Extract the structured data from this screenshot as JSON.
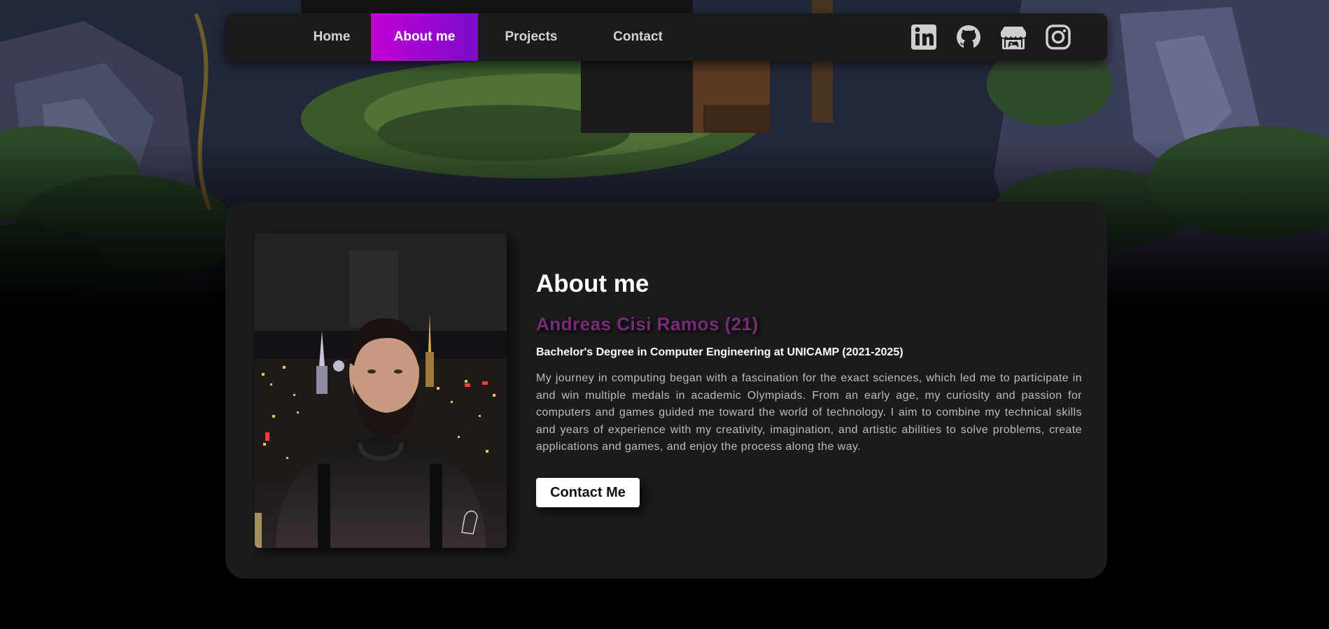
{
  "nav": {
    "items": [
      {
        "label": "Home",
        "active": false
      },
      {
        "label": "About me",
        "active": true
      },
      {
        "label": "Projects",
        "active": false
      },
      {
        "label": "Contact",
        "active": false
      }
    ],
    "social_icons": [
      "linkedin-icon",
      "github-icon",
      "itch-io-icon",
      "instagram-icon"
    ]
  },
  "about": {
    "title": "About me",
    "name_age": "Andreas Cisi Ramos (21)",
    "degree": "Bachelor's Degree in Computer Engineering at UNICAMP (2021-2025)",
    "bio": "My journey in computing began with a fascination for the exact sciences, which led me to participate in and win multiple medals in academic Olympiads. From an early age, my curiosity and passion for computers and games guided me toward the world of technology. I aim to combine my technical skills and years of experience with my creativity, imagination, and artistic abilities to solve problems, create applications and games, and enjoy the process along the way.",
    "contact_button": "Contact Me"
  },
  "colors": {
    "accent_start": "#c100d4",
    "accent_end": "#7a0cc9",
    "name_color": "#7b2a79",
    "card_bg": "#1b1b1b",
    "page_bg": "#000000"
  }
}
